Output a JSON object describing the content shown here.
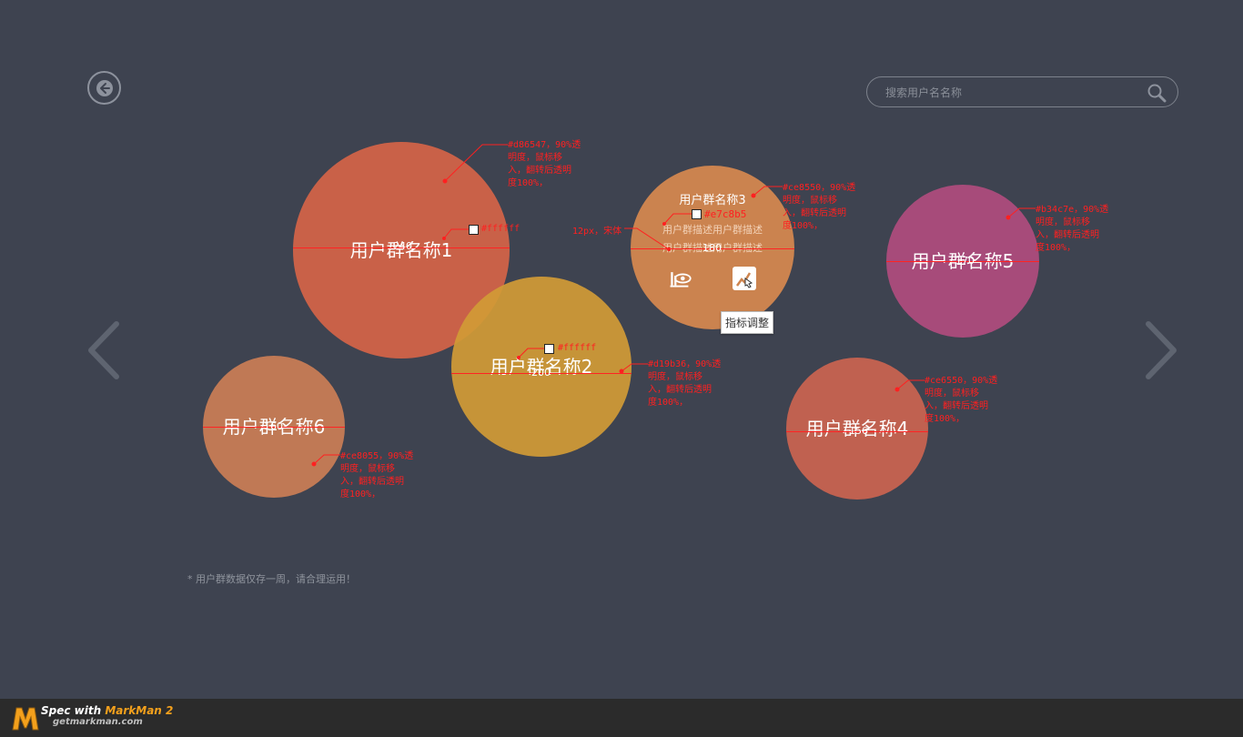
{
  "header": {
    "search_placeholder": "搜索用户名名称"
  },
  "bubbles": [
    {
      "name": "用户群名称1",
      "diameter": 240,
      "color": "#d86547",
      "size_label": "240"
    },
    {
      "name": "用户群名称2",
      "diameter": 200,
      "color": "#d19b36",
      "size_label": "200"
    },
    {
      "name": "用户群名称3",
      "diameter": 180,
      "color": "#ce8550",
      "size_label": "180",
      "desc_line1": "用户群描述用户群描述",
      "desc_line2": "用户群描述用户群描述"
    },
    {
      "name": "用户群名称4",
      "diameter": 156,
      "color": "#ce6550",
      "size_label": "156"
    },
    {
      "name": "用户群名称5",
      "diameter": 170,
      "color": "#b34c7e",
      "size_label": "170"
    },
    {
      "name": "用户群名称6",
      "diameter": 160,
      "color": "#ce8055",
      "size_label": "160"
    }
  ],
  "tooltip": "指标调整",
  "annotations": {
    "b1_note": "#d86547，90%透\n明度，鼠标移\n入，翻转后透明\n度100%，",
    "b1_swatch": "#ffffff",
    "b2_note": "#d19b36，90%透\n明度，鼠标移\n入，翻转后透明\n度100%，",
    "b2_swatch": "#ffffff",
    "b3_note": "#ce8550，90%透\n明度，鼠标移\n入，翻转后透明\n度100%，",
    "b3_swatch": "#e7c8b5",
    "b3_font": "12px，宋体",
    "b4_note": "#ce6550，90%透\n明度，鼠标移\n入，翻转后透明\n度100%，",
    "b5_note": "#b34c7e，90%透\n明度，鼠标移\n入，翻转后透明\n度100%，",
    "b6_note": "#ce8055，90%透\n明度，鼠标移\n入，翻转后透明\n度100%，"
  },
  "footnote": "* 用户群数据仅存一周，请合理运用！",
  "brand": {
    "line1_prefix": "Spec with ",
    "line1_name": "MarkMan 2",
    "line2": "getmarkman.com"
  },
  "icons": [
    "back-icon",
    "search-icon",
    "chevron-left-icon",
    "chevron-right-icon",
    "view-icon",
    "adjust-icon"
  ]
}
